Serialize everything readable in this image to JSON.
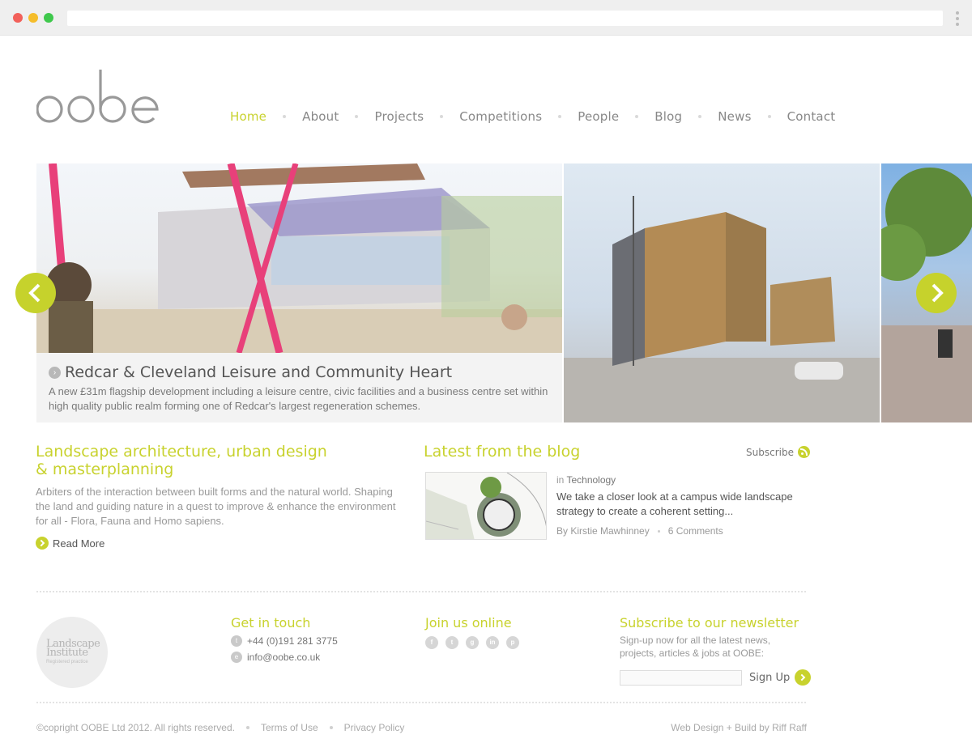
{
  "brand": {
    "logo_text": "oobe",
    "accent": "#c8d22e"
  },
  "nav": {
    "items": [
      {
        "label": "Home",
        "active": true
      },
      {
        "label": "About"
      },
      {
        "label": "Projects"
      },
      {
        "label": "Competitions"
      },
      {
        "label": "People"
      },
      {
        "label": "Blog"
      },
      {
        "label": "News"
      },
      {
        "label": "Contact"
      }
    ]
  },
  "slider": {
    "caption_title": "Redcar & Cleveland Leisure and Community Heart",
    "caption_text": "A new £31m flagship development including a leisure centre, civic facilities and a business centre set within high quality public realm forming one of Redcar's largest regeneration schemes.",
    "prev_icon": "chevron-left-icon",
    "next_icon": "chevron-right-icon"
  },
  "intro": {
    "heading_line1": "Landscape architecture, urban design",
    "heading_line2": "& masterplanning",
    "text": "Arbiters of the interaction between built forms and the natural world. Shaping the land and guiding nature in a quest to improve & enhance the environment for all - Flora, Fauna and Homo sapiens.",
    "read_more": "Read More"
  },
  "blog": {
    "heading": "Latest from the blog",
    "subscribe": "Subscribe",
    "category_prefix": "in",
    "category": "Technology",
    "title": "We take a closer look at a campus wide landscape strategy to create a coherent setting...",
    "author": "By Kirstie Mawhinney",
    "comments": "6 Comments"
  },
  "footer": {
    "li_logo_line1": "Landscape",
    "li_logo_line2": "Institute",
    "li_logo_line3": "Registered practice",
    "get_in_touch": "Get in touch",
    "phone_icon": "t",
    "phone": "+44 (0)191 281 3775",
    "email_icon": "e",
    "email": "info@oobe.co.uk",
    "join_us": "Join us online",
    "social": [
      "f",
      "t",
      "g",
      "in",
      "p"
    ],
    "newsletter_heading": "Subscribe to our newsletter",
    "newsletter_text": "Sign-up now for all the latest news, projects, articles & jobs at OOBE:",
    "newsletter_placeholder": "",
    "sign_up": "Sign Up",
    "copyright": "©copright OOBE Ltd 2012. All rights reserved.",
    "terms": "Terms of Use",
    "privacy": "Privacy Policy",
    "credit": "Web Design + Build by Riff Raff"
  }
}
